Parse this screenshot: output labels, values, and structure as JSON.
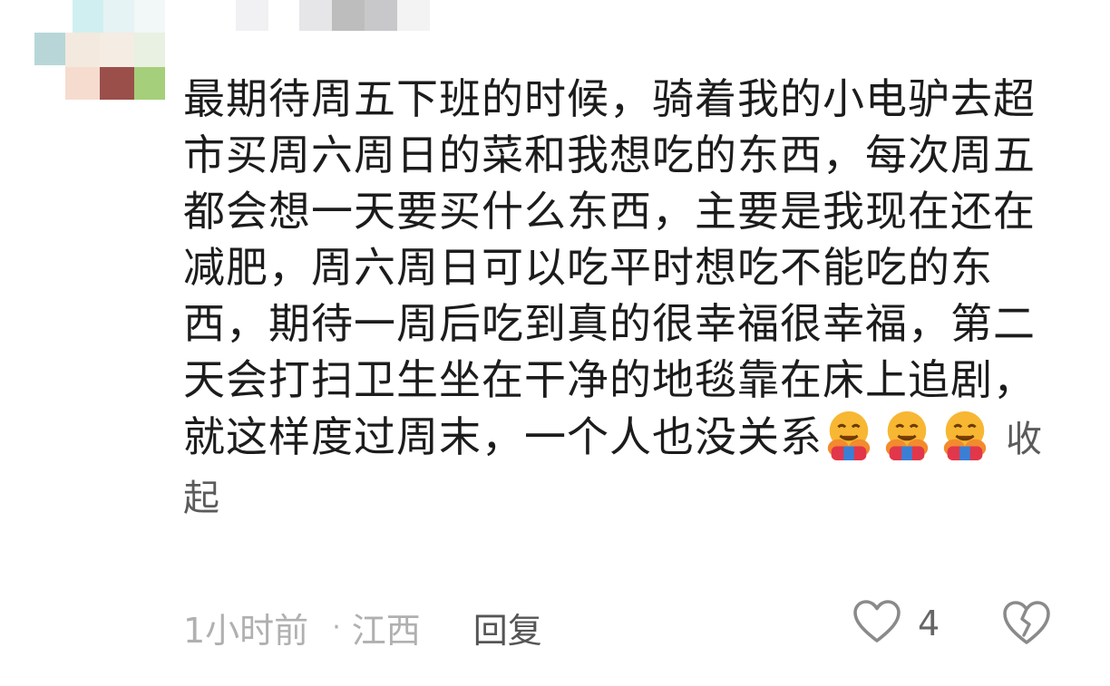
{
  "comment": {
    "text": "最期待周五下班的时候，骑着我的小电驴去超市买周六周日的菜和我想吃的东西，每次周五都会想一天要买什么东西，主要是我现在还在减肥，周六周日可以吃平时想吃不能吃的东西，期待一周后吃到真的很幸福很幸福，第二天会打扫卫生坐在干净的地毯靠在床上追剧，就这样度过周末，一个人也没关系",
    "emoji_icon": "hugging-face-emoji",
    "emoji_count": 3,
    "collapse_label": "收起"
  },
  "meta": {
    "time": "1小时前",
    "separator": "·",
    "region": "江西",
    "reply_label": "回复"
  },
  "actions": {
    "like_icon": "heart-outline-icon",
    "like_count": "4",
    "dislike_icon": "broken-heart-icon"
  },
  "colors": {
    "text": "#1c1c1c",
    "muted": "#b0b0b0",
    "icon": "#8a8a8a"
  }
}
